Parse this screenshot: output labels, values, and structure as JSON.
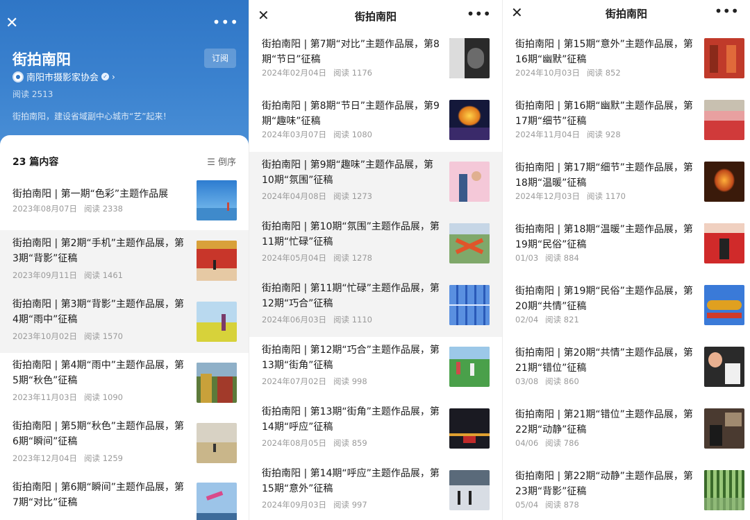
{
  "panel1": {
    "title": "街拍南阳",
    "subscribe": "订阅",
    "source": "南阳市摄影家协会",
    "reads": "阅读 2513",
    "desc": "街拍南阳，建设省域副中心城市“艺”起来！",
    "count": "23 篇内容",
    "sort": "倒序",
    "items": [
      {
        "title": "街拍南阳 | 第一期“色彩”主题作品展",
        "date": "2023年08月07日",
        "reads": "阅读 2338"
      },
      {
        "title": "街拍南阳 | 第2期“手机”主题作品展，第3期“背影”征稿",
        "date": "2023年09月11日",
        "reads": "阅读 1461"
      },
      {
        "title": "街拍南阳 | 第3期“背影”主题作品展，第4期“雨中”征稿",
        "date": "2023年10月02日",
        "reads": "阅读 1570"
      },
      {
        "title": "街拍南阳 | 第4期“雨中”主题作品展，第5期“秋色”征稿",
        "date": "2023年11月03日",
        "reads": "阅读 1090"
      },
      {
        "title": "街拍南阳 | 第5期“秋色”主题作品展，第6期“瞬间”征稿",
        "date": "2023年12月04日",
        "reads": "阅读 1259"
      },
      {
        "title": "街拍南阳 | 第6期“瞬间”主题作品展，第7期“对比”征稿",
        "date": "",
        "reads": ""
      }
    ]
  },
  "panel2": {
    "title": "街拍南阳",
    "items": [
      {
        "title": "街拍南阳 | 第7期“对比”主题作品展，第8期“节日”征稿",
        "date": "2024年02月04日",
        "reads": "阅读 1176"
      },
      {
        "title": "街拍南阳 | 第8期“节日”主题作品展，第9期“趣味”征稿",
        "date": "2024年03月07日",
        "reads": "阅读 1080"
      },
      {
        "title": "街拍南阳 | 第9期“趣味”主题作品展，第10期“氛围”征稿",
        "date": "2024年04月08日",
        "reads": "阅读 1273"
      },
      {
        "title": "街拍南阳 | 第10期“氛围”主题作品展，第11期“忙碌”征稿",
        "date": "2024年05月04日",
        "reads": "阅读 1278"
      },
      {
        "title": "街拍南阳 | 第11期“忙碌”主题作品展，第12期“巧合”征稿",
        "date": "2024年06月03日",
        "reads": "阅读 1110"
      },
      {
        "title": "街拍南阳 | 第12期“巧合”主题作品展，第13期“街角”征稿",
        "date": "2024年07月02日",
        "reads": "阅读 998"
      },
      {
        "title": "街拍南阳 | 第13期“街角”主题作品展，第14期“呼应”征稿",
        "date": "2024年08月05日",
        "reads": "阅读 859"
      },
      {
        "title": "街拍南阳 | 第14期“呼应”主题作品展，第15期“意外”征稿",
        "date": "2024年09月03日",
        "reads": "阅读 997"
      }
    ]
  },
  "panel3": {
    "title": "街拍南阳",
    "items": [
      {
        "title": "街拍南阳 | 第15期“意外”主题作品展，第16期“幽默”征稿",
        "date": "2024年10月03日",
        "reads": "阅读 852"
      },
      {
        "title": "街拍南阳 | 第16期“幽默”主题作品展，第17期“细节”征稿",
        "date": "2024年11月04日",
        "reads": "阅读 928"
      },
      {
        "title": "街拍南阳 | 第17期“细节”主题作品展，第18期“温暖”征稿",
        "date": "2024年12月03日",
        "reads": "阅读 1170"
      },
      {
        "title": "街拍南阳 | 第18期“温暖”主题作品展，第19期“民俗”征稿",
        "date": "01/03",
        "reads": "阅读 884"
      },
      {
        "title": "街拍南阳 | 第19期“民俗”主题作品展，第20期“共情”征稿",
        "date": "02/04",
        "reads": "阅读 821"
      },
      {
        "title": "街拍南阳 | 第20期“共情”主题作品展，第21期“错位”征稿",
        "date": "03/08",
        "reads": "阅读 860"
      },
      {
        "title": "街拍南阳 | 第21期“错位”主题作品展，第22期“动静”征稿",
        "date": "04/06",
        "reads": "阅读 786"
      },
      {
        "title": "街拍南阳 | 第22期“动静”主题作品展，第23期“背影”征稿",
        "date": "05/04",
        "reads": "阅读 878"
      }
    ]
  },
  "icons": {
    "close": "close-icon",
    "more": "more-icon",
    "sort": "sort-icon"
  },
  "colors": {
    "header_blue": "#2f76c6",
    "highlight": "#f3f3f3",
    "meta_gray": "#9a9a9a"
  }
}
